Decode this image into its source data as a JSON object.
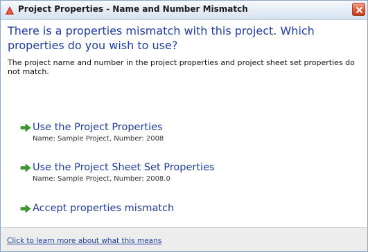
{
  "window": {
    "title": "Project Properties - Name and Number Mismatch",
    "app_icon": "autodesk-triangle-icon",
    "close_icon": "close-icon"
  },
  "main": {
    "heading": "There is a properties mismatch with this project. Which properties do you wish to use?",
    "description": "The project name and number in the project properties and project sheet set properties do not match."
  },
  "options": [
    {
      "label": "Use the Project Properties",
      "detail": "Name: Sample Project, Number: 2008"
    },
    {
      "label": "Use the Project Sheet Set Properties",
      "detail": "Name: Sample Project, Number: 2008.0"
    },
    {
      "label": "Accept properties mismatch"
    }
  ],
  "footer": {
    "link": "Click to learn more about what this means"
  },
  "colors": {
    "link_blue": "#1f3f9e",
    "arrow_green": "#3a9a2a",
    "close_red": "#df5b3c"
  }
}
